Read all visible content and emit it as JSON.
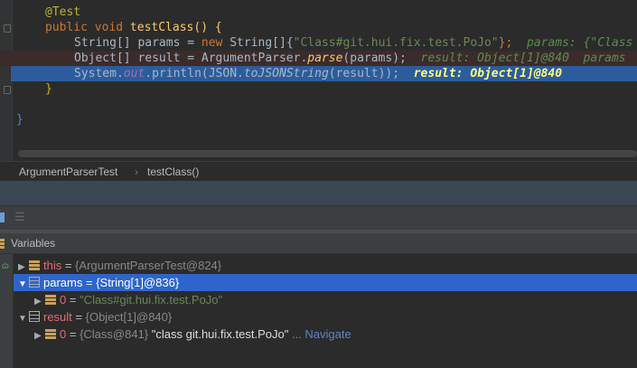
{
  "code": {
    "annotation": "@Test",
    "sig_kw": "public void",
    "sig_name": "testClass",
    "sig_rest": "() {",
    "l3_a": "String[] params = ",
    "l3_new": "new",
    "l3_b": " String[]{",
    "l3_str": "\"Class#git.hui.fix.test.PoJo\"",
    "l3_c": "};",
    "l3_hint": "params: {\"Class",
    "l4_a": "Object[] result = ArgumentParser.",
    "l4_parse": "parse",
    "l4_b": "(params);",
    "l4_hint": "result: Object[1]@840  params",
    "l5_a": "System.",
    "l5_out": "out",
    "l5_b": ".println(JSON.",
    "l5_fn": "toJSONString",
    "l5_c": "(result));",
    "l5_hint": "result: Object[1]@840",
    "close1": "}",
    "close2": "}"
  },
  "breadcrumb": {
    "items": [
      "ArgumentParserTest",
      "testClass()"
    ],
    "sep": "›"
  },
  "variables": {
    "title": "Variables",
    "rows": [
      {
        "name": "this",
        "value": "{ArgumentParserTest@824}",
        "extra": "",
        "nav": ""
      },
      {
        "name": "params",
        "value": "{String[1]@836}",
        "extra": "",
        "nav": ""
      },
      {
        "name": "0",
        "value": "\"Class#git.hui.fix.test.PoJo\"",
        "extra": "",
        "nav": ""
      },
      {
        "name": "result",
        "value": "{Object[1]@840}",
        "extra": "",
        "nav": ""
      },
      {
        "name": "0",
        "value": "{Class@841}",
        "extra": "\"class git.hui.fix.test.PoJo\"",
        "nav": "... Navigate"
      }
    ]
  }
}
